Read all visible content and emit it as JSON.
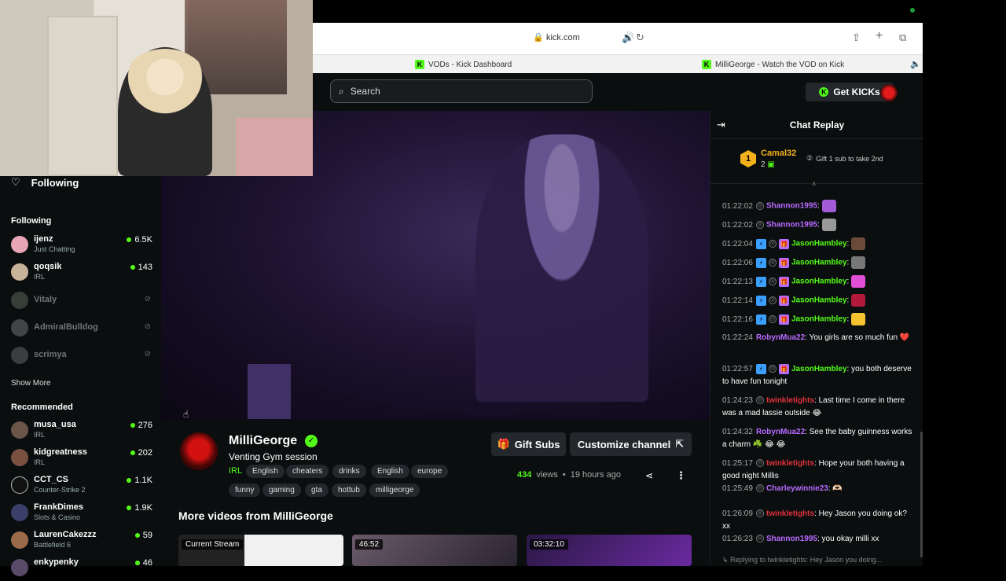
{
  "browser": {
    "url": "kick.com",
    "tabs": [
      {
        "title": "VODs - Kick Dashboard"
      },
      {
        "title": "MilliGeorge - Watch the VOD on Kick"
      }
    ]
  },
  "header": {
    "search_placeholder": "Search",
    "get_kicks_label": "Get KICKs"
  },
  "sidebar": {
    "following_header": "Following",
    "following_section": "Following",
    "following": [
      {
        "name": "ijenz",
        "category": "Just Chatting",
        "viewers": "6.5K",
        "live": true
      },
      {
        "name": "qoqsik",
        "category": "IRL",
        "viewers": "143",
        "live": true
      },
      {
        "name": "Vitaly",
        "live": false
      },
      {
        "name": "AdmiralBulldog",
        "live": false
      },
      {
        "name": "scrimya",
        "live": false
      }
    ],
    "show_more": "Show More",
    "recommended_section": "Recommended",
    "recommended": [
      {
        "name": "musa_usa",
        "category": "IRL",
        "viewers": "276"
      },
      {
        "name": "kidgreatness",
        "category": "IRL",
        "viewers": "202"
      },
      {
        "name": "CCT_CS",
        "category": "Counter-Strike 2",
        "viewers": "1.1K"
      },
      {
        "name": "FrankDimes",
        "category": "Slots & Casino",
        "viewers": "1.9K"
      },
      {
        "name": "LaurenCakezzz",
        "category": "Battlefield 6",
        "viewers": "59"
      },
      {
        "name": "enkypenky",
        "category": "",
        "viewers": "46"
      }
    ]
  },
  "channel": {
    "name": "MilliGeorge",
    "stream_title": "Venting Gym session",
    "category": "IRL",
    "tags_row1": [
      "English",
      "cheaters",
      "drinks",
      "English",
      "europe"
    ],
    "tags_row2": [
      "funny",
      "gaming",
      "gta",
      "hottub",
      "milligeorge"
    ],
    "gift_subs_label": "Gift Subs",
    "customize_label": "Customize channel",
    "views": "434",
    "views_label": "views",
    "time_ago": "19 hours ago",
    "more_videos_title": "More videos from MilliGeorge",
    "thumbnails": [
      {
        "label": "Current Stream"
      },
      {
        "label": "46:52"
      },
      {
        "label": "03:32:10"
      }
    ]
  },
  "chat": {
    "title": "Chat Replay",
    "top_gifter": {
      "rank": "1",
      "name": "Camal32",
      "count": "2"
    },
    "gift_tip": "Gift 1 sub to take 2nd",
    "messages": [
      {
        "time": "01:22:02",
        "user": "Shannon1995",
        "color": "#b86bff",
        "text": "",
        "badges": "circ",
        "emote": "#a35bd8"
      },
      {
        "time": "01:22:02",
        "user": "Shannon1995",
        "color": "#b86bff",
        "text": "",
        "badges": "circ",
        "emote": "#999999"
      },
      {
        "time": "01:22:04",
        "user": "JasonHambley",
        "color": "#53fc18",
        "text": "",
        "badges": "full",
        "emote": "#6b4a3a"
      },
      {
        "time": "01:22:06",
        "user": "JasonHambley",
        "color": "#53fc18",
        "text": "",
        "badges": "full",
        "emote": "#777777"
      },
      {
        "time": "01:22:13",
        "user": "JasonHambley",
        "color": "#53fc18",
        "text": "",
        "badges": "full",
        "emote": "#e04fd6"
      },
      {
        "time": "01:22:14",
        "user": "JasonHambley",
        "color": "#53fc18",
        "text": "",
        "badges": "full",
        "emote": "#b11a3a"
      },
      {
        "time": "01:22:16",
        "user": "JasonHambley",
        "color": "#53fc18",
        "text": "",
        "badges": "full",
        "emote": "#f4c430"
      },
      {
        "time": "01:22:24",
        "user": "RobynMua22",
        "color": "#b86bff",
        "text": "You girls are so much fun ❤️",
        "badges": "none"
      },
      {
        "time": "01:22:57",
        "user": "JasonHambley",
        "color": "#53fc18",
        "text": "you both deserve to have fun tonight",
        "badges": "full"
      },
      {
        "time": "01:24:23",
        "user": "twinkletights",
        "color": "#e0313b",
        "text": "Last time I come in there was a mad lassie outside 😂",
        "badges": "circ"
      },
      {
        "time": "01:24:32",
        "user": "RobynMua22",
        "color": "#b86bff",
        "text": "See the baby guinness works a charm ☘️ 😂 😂",
        "badges": "none"
      },
      {
        "time": "01:25:17",
        "user": "twinkletights",
        "color": "#e0313b",
        "text": "Hope your both having a good night Millis",
        "badges": "circ"
      },
      {
        "time": "01:25:49",
        "user": "Charleywinnie23",
        "color": "#b86bff",
        "text": "🫶🏻",
        "badges": "circ"
      },
      {
        "time": "01:26:09",
        "user": "twinkletights",
        "color": "#e0313b",
        "text": "Hey Jason you doing ok? xx",
        "badges": "circ"
      },
      {
        "time": "01:26:23",
        "user": "Shannon1995",
        "color": "#b86bff",
        "text": "you okay milli xx",
        "badges": "circ"
      }
    ],
    "reply_preview": "Replying to twinkletights: Hey Jason you doing..."
  },
  "colors": {
    "brand": "#53fc18",
    "background": "#0b0e0f",
    "button": "#24272c"
  }
}
